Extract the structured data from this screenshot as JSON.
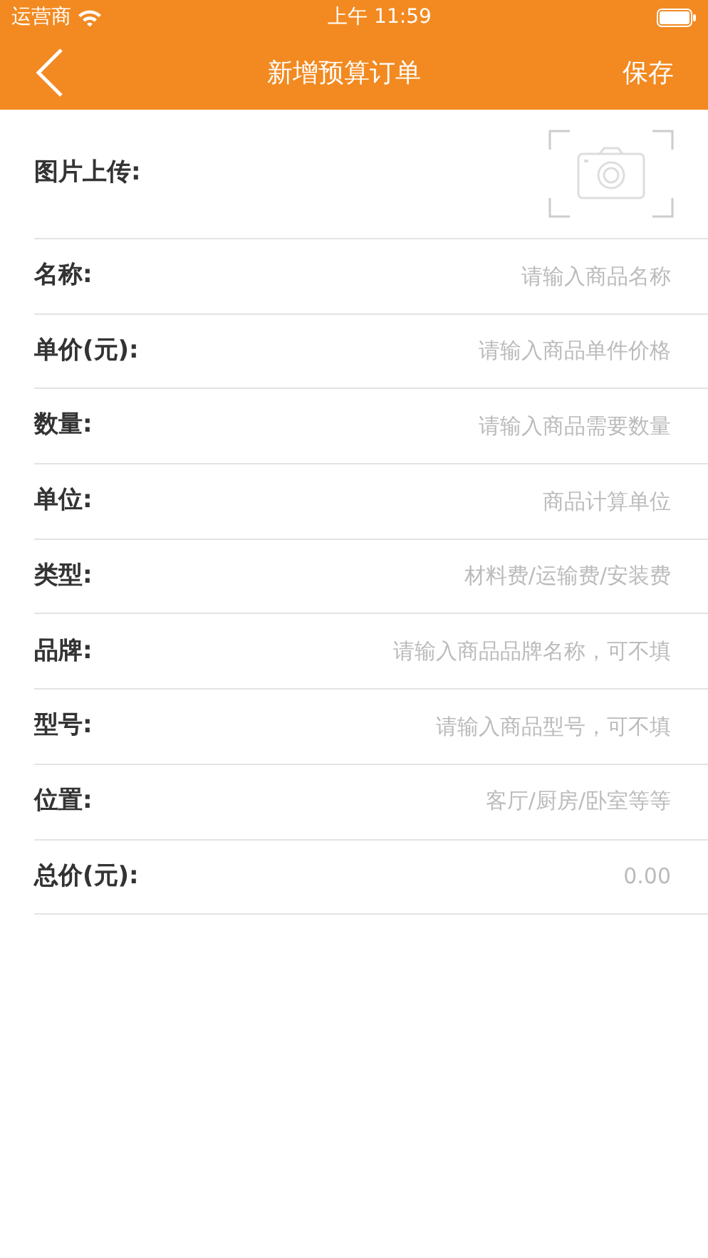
{
  "status_bar": {
    "carrier": "运营商",
    "time": "上午 11:59"
  },
  "nav_bar": {
    "title": "新增预算订单",
    "action": "保存"
  },
  "upload": {
    "label": "图片上传:"
  },
  "fields": [
    {
      "label": "名称:",
      "placeholder": "请输入商品名称"
    },
    {
      "label": "单价(元):",
      "placeholder": "请输入商品单件价格"
    },
    {
      "label": "数量:",
      "placeholder": "请输入商品需要数量"
    },
    {
      "label": "单位:",
      "placeholder": "商品计算单位"
    },
    {
      "label": "类型:",
      "placeholder": "材料费/运输费/安装费"
    },
    {
      "label": "品牌:",
      "placeholder": "请输入商品品牌名称，可不填"
    },
    {
      "label": "型号:",
      "placeholder": "请输入商品型号，可不填"
    },
    {
      "label": "位置:",
      "placeholder": "客厅/厨房/卧室等等"
    },
    {
      "label": "总价(元):",
      "placeholder": "0.00"
    }
  ]
}
